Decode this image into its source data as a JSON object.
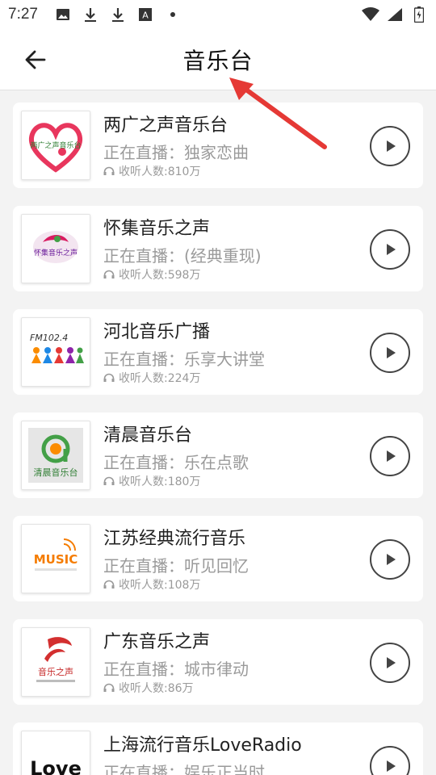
{
  "status_bar": {
    "time": "7:27",
    "left_icons": [
      "image-icon",
      "download-icon",
      "download-icon",
      "font-icon",
      "dot-icon"
    ],
    "right_icons": [
      "wifi-icon",
      "signal-icon",
      "battery-icon"
    ]
  },
  "header": {
    "title": "音乐台",
    "back_icon": "arrow-left-icon"
  },
  "colors": {
    "background": "#f3f3f3",
    "card": "#ffffff",
    "annotation_arrow": "#e53935",
    "secondary_text": "#9a9a9a"
  },
  "stations": [
    {
      "name": "两广之声音乐台",
      "now_playing": "正在直播：独家恋曲",
      "listeners": "收听人数:810万",
      "logo": "heart-logo",
      "logo_text": "两广之声音乐台"
    },
    {
      "name": "怀集音乐之声",
      "now_playing": "正在直播：(经典重现)",
      "listeners": "收听人数:598万",
      "logo": "fish-logo",
      "logo_text": "怀集音乐之声"
    },
    {
      "name": "河北音乐广播",
      "now_playing": "正在直播：乐享大讲堂",
      "listeners": "收听人数:224万",
      "logo": "people-logo",
      "logo_text": "FM102.4"
    },
    {
      "name": "清晨音乐台",
      "now_playing": "正在直播：乐在点歌",
      "listeners": "收听人数:180万",
      "logo": "q-logo",
      "logo_text": "清晨音乐台"
    },
    {
      "name": "江苏经典流行音乐",
      "now_playing": "正在直播：听见回忆",
      "listeners": "收听人数:108万",
      "logo": "music-logo",
      "logo_text": "MUSIC"
    },
    {
      "name": "广东音乐之声",
      "now_playing": "正在直播：城市律动",
      "listeners": "收听人数:86万",
      "logo": "guangdong-logo",
      "logo_text": "音乐之声"
    },
    {
      "name": "上海流行音乐LoveRadio",
      "now_playing": "正在直播：娱乐正当时",
      "listeners": "",
      "logo": "love-logo",
      "logo_text": "Love"
    }
  ]
}
